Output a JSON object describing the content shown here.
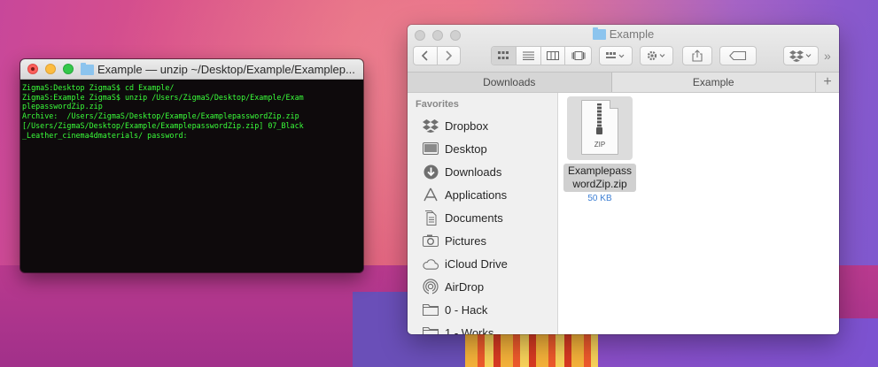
{
  "terminal": {
    "title": "Example — unzip ~/Desktop/Example/Examplep...",
    "lines": [
      "ZigmaS:Desktop ZigmaS$ cd Example/",
      "ZigmaS:Example ZigmaS$ unzip /Users/ZigmaS/Desktop/Example/Exam",
      "plepasswordZip.zip",
      "Archive:  /Users/ZigmaS/Desktop/Example/ExamplepasswordZip.zip",
      "[/Users/ZigmaS/Desktop/Example/ExamplepasswordZip.zip] 07_Black",
      "_Leather_cinema4dmaterials/ password:"
    ]
  },
  "finder": {
    "title": "Example",
    "tabs": [
      {
        "label": "Downloads"
      },
      {
        "label": "Example"
      }
    ],
    "tab_add": "+",
    "sidebar": {
      "heading": "Favorites",
      "items": [
        {
          "label": "Dropbox",
          "icon": "dropbox-icon"
        },
        {
          "label": "Desktop",
          "icon": "desktop-icon"
        },
        {
          "label": "Downloads",
          "icon": "downloads-icon"
        },
        {
          "label": "Applications",
          "icon": "applications-icon"
        },
        {
          "label": "Documents",
          "icon": "documents-icon"
        },
        {
          "label": "Pictures",
          "icon": "pictures-icon"
        },
        {
          "label": "iCloud Drive",
          "icon": "icloud-icon"
        },
        {
          "label": "AirDrop",
          "icon": "airdrop-icon"
        },
        {
          "label": "0 - Hack",
          "icon": "folder-icon"
        },
        {
          "label": "1 - Works",
          "icon": "folder-icon"
        }
      ]
    },
    "file": {
      "name_line1": "Examplepass",
      "name_line2": "wordZip.zip",
      "size": "50 KB",
      "badge": "ZIP"
    },
    "toolbar_overflow": "»"
  }
}
